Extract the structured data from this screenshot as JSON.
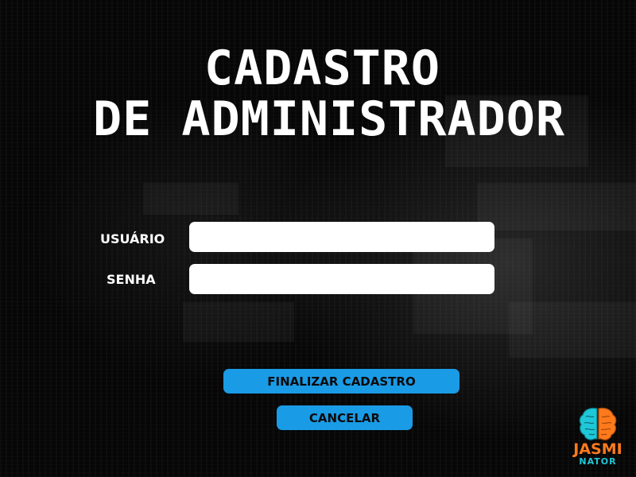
{
  "title": {
    "line1": "CADASTRO",
    "line2": "DE ADMINISTRADOR"
  },
  "form": {
    "user_label": "USUÁRIO",
    "user_value": "",
    "user_placeholder": "",
    "password_label": "SENHA",
    "password_value": "",
    "password_placeholder": ""
  },
  "actions": {
    "finish_label": "FINALIZAR CADASTRO",
    "cancel_label": "CANCELAR"
  },
  "logo": {
    "icon": "brain-icon",
    "text_top": "JASMI",
    "text_bottom": "NATOR"
  },
  "colors": {
    "background": "#060606",
    "accent_button": "#1a9be6",
    "logo_orange": "#ff7a1c",
    "logo_cyan": "#1ec8d8"
  }
}
